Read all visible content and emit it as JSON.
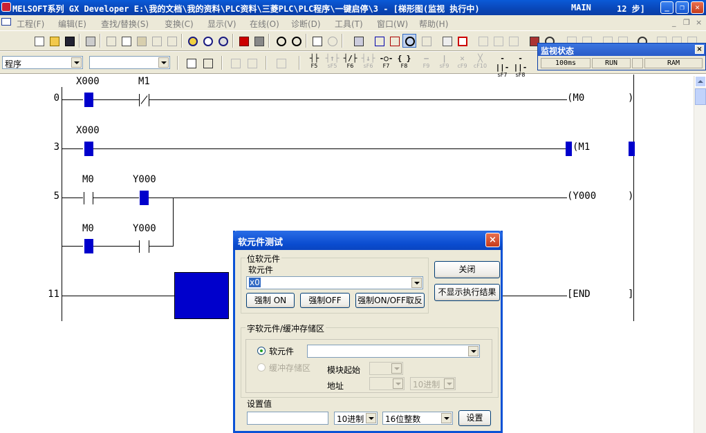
{
  "titlebar": {
    "title": "MELSOFT系列 GX Developer E:\\我的文档\\我的资料\\PLC资料\\三菱PLC\\PLC程序\\一键启停\\3 - [梯形图(监视 执行中)",
    "mode": "MAIN",
    "steps": "12 步]",
    "minimize": "_",
    "restore": "❐",
    "close": "✕"
  },
  "menubar": {
    "items": [
      "工程(F)",
      "编辑(E)",
      "查找/替换(S)",
      "变换(C)",
      "显示(V)",
      "在线(O)",
      "诊断(D)",
      "工具(T)",
      "窗口(W)",
      "帮助(H)"
    ],
    "mdi_min": "_",
    "mdi_restore": "❐",
    "mdi_close": "×"
  },
  "toolbar2": {
    "data_type_combo": "程序",
    "second_combo": "",
    "fkeys": [
      {
        "glyph": "┤├",
        "label": "F5",
        "enabled": true
      },
      {
        "glyph": "┤↑├",
        "label": "sF5",
        "enabled": false
      },
      {
        "glyph": "┤/├",
        "label": "F6",
        "enabled": true
      },
      {
        "glyph": "┤↓├",
        "label": "sF6",
        "enabled": false
      },
      {
        "glyph": "-○-",
        "label": "F7",
        "enabled": true
      },
      {
        "glyph": "{ }",
        "label": "F8",
        "enabled": true
      },
      {
        "glyph": "—",
        "label": "F9",
        "enabled": false
      },
      {
        "glyph": "|",
        "label": "sF9",
        "enabled": false
      },
      {
        "glyph": "✕",
        "label": "cF9",
        "enabled": false
      },
      {
        "glyph": "╳",
        "label": "cF10",
        "enabled": false
      },
      {
        "glyph": "-||-",
        "label": "sF7",
        "enabled": true
      },
      {
        "glyph": "-||-",
        "label": "sF8",
        "enabled": true
      }
    ]
  },
  "monitor": {
    "title": "监视状态",
    "close": "×",
    "scan_time": "100ms",
    "status": "RUN",
    "memory": "RAM"
  },
  "ladder": {
    "rungs": [
      {
        "step": "0",
        "contacts": [
          "X000",
          "M1"
        ],
        "coil": "(M0",
        "coil_end": ")"
      },
      {
        "step": "3",
        "contacts": [
          "X000"
        ],
        "coil": "(M1",
        "coil_end": ")"
      },
      {
        "step": "5",
        "contacts": [
          "M0",
          "Y000"
        ],
        "coil": "(Y000",
        "coil_end": ")",
        "branch": [
          "M0",
          "Y000"
        ]
      },
      {
        "step": "11",
        "contacts": [],
        "coil": "[END",
        "coil_end": "]"
      }
    ]
  },
  "dialog": {
    "title": "软元件测试",
    "close": "×",
    "bit_group": "位软元件",
    "device_label": "软元件",
    "device_value": "x0",
    "force_on": "强制 ON",
    "force_off": "强制OFF",
    "force_toggle": "强制ON/OFF取反",
    "close_button": "关闭",
    "hide_result_button": "不显示执行结果",
    "word_group": "字软元件/缓冲存储区",
    "radio_device": "软元件",
    "radio_buffer": "缓冲存储区",
    "module_start": "模块起始",
    "address": "地址",
    "address_radix": "10进制",
    "set_value_label": "设置值",
    "set_value": "",
    "radix": "10进制",
    "data_size": "16位整数",
    "set_button": "设置"
  }
}
